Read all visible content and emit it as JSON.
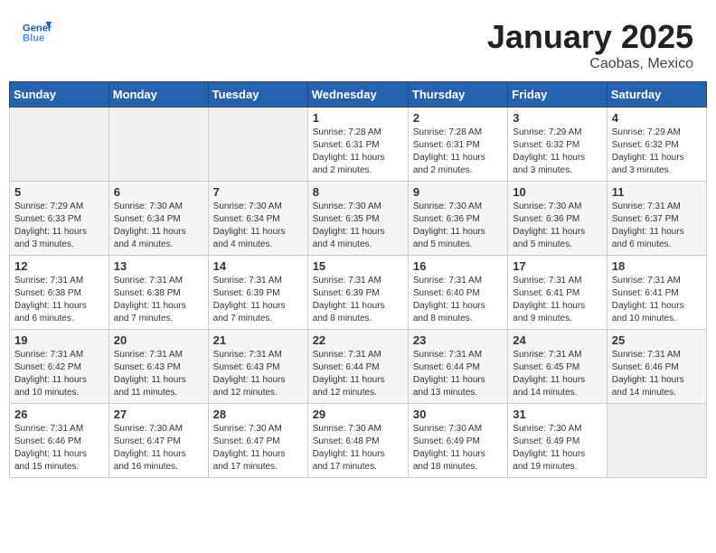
{
  "header": {
    "logo_line1": "General",
    "logo_line2": "Blue",
    "month": "January 2025",
    "location": "Caobas, Mexico"
  },
  "weekdays": [
    "Sunday",
    "Monday",
    "Tuesday",
    "Wednesday",
    "Thursday",
    "Friday",
    "Saturday"
  ],
  "weeks": [
    [
      {
        "day": "",
        "info": ""
      },
      {
        "day": "",
        "info": ""
      },
      {
        "day": "",
        "info": ""
      },
      {
        "day": "1",
        "info": "Sunrise: 7:28 AM\nSunset: 6:31 PM\nDaylight: 11 hours\nand 2 minutes."
      },
      {
        "day": "2",
        "info": "Sunrise: 7:28 AM\nSunset: 6:31 PM\nDaylight: 11 hours\nand 2 minutes."
      },
      {
        "day": "3",
        "info": "Sunrise: 7:29 AM\nSunset: 6:32 PM\nDaylight: 11 hours\nand 3 minutes."
      },
      {
        "day": "4",
        "info": "Sunrise: 7:29 AM\nSunset: 6:32 PM\nDaylight: 11 hours\nand 3 minutes."
      }
    ],
    [
      {
        "day": "5",
        "info": "Sunrise: 7:29 AM\nSunset: 6:33 PM\nDaylight: 11 hours\nand 3 minutes."
      },
      {
        "day": "6",
        "info": "Sunrise: 7:30 AM\nSunset: 6:34 PM\nDaylight: 11 hours\nand 4 minutes."
      },
      {
        "day": "7",
        "info": "Sunrise: 7:30 AM\nSunset: 6:34 PM\nDaylight: 11 hours\nand 4 minutes."
      },
      {
        "day": "8",
        "info": "Sunrise: 7:30 AM\nSunset: 6:35 PM\nDaylight: 11 hours\nand 4 minutes."
      },
      {
        "day": "9",
        "info": "Sunrise: 7:30 AM\nSunset: 6:36 PM\nDaylight: 11 hours\nand 5 minutes."
      },
      {
        "day": "10",
        "info": "Sunrise: 7:30 AM\nSunset: 6:36 PM\nDaylight: 11 hours\nand 5 minutes."
      },
      {
        "day": "11",
        "info": "Sunrise: 7:31 AM\nSunset: 6:37 PM\nDaylight: 11 hours\nand 6 minutes."
      }
    ],
    [
      {
        "day": "12",
        "info": "Sunrise: 7:31 AM\nSunset: 6:38 PM\nDaylight: 11 hours\nand 6 minutes."
      },
      {
        "day": "13",
        "info": "Sunrise: 7:31 AM\nSunset: 6:38 PM\nDaylight: 11 hours\nand 7 minutes."
      },
      {
        "day": "14",
        "info": "Sunrise: 7:31 AM\nSunset: 6:39 PM\nDaylight: 11 hours\nand 7 minutes."
      },
      {
        "day": "15",
        "info": "Sunrise: 7:31 AM\nSunset: 6:39 PM\nDaylight: 11 hours\nand 8 minutes."
      },
      {
        "day": "16",
        "info": "Sunrise: 7:31 AM\nSunset: 6:40 PM\nDaylight: 11 hours\nand 8 minutes."
      },
      {
        "day": "17",
        "info": "Sunrise: 7:31 AM\nSunset: 6:41 PM\nDaylight: 11 hours\nand 9 minutes."
      },
      {
        "day": "18",
        "info": "Sunrise: 7:31 AM\nSunset: 6:41 PM\nDaylight: 11 hours\nand 10 minutes."
      }
    ],
    [
      {
        "day": "19",
        "info": "Sunrise: 7:31 AM\nSunset: 6:42 PM\nDaylight: 11 hours\nand 10 minutes."
      },
      {
        "day": "20",
        "info": "Sunrise: 7:31 AM\nSunset: 6:43 PM\nDaylight: 11 hours\nand 11 minutes."
      },
      {
        "day": "21",
        "info": "Sunrise: 7:31 AM\nSunset: 6:43 PM\nDaylight: 11 hours\nand 12 minutes."
      },
      {
        "day": "22",
        "info": "Sunrise: 7:31 AM\nSunset: 6:44 PM\nDaylight: 11 hours\nand 12 minutes."
      },
      {
        "day": "23",
        "info": "Sunrise: 7:31 AM\nSunset: 6:44 PM\nDaylight: 11 hours\nand 13 minutes."
      },
      {
        "day": "24",
        "info": "Sunrise: 7:31 AM\nSunset: 6:45 PM\nDaylight: 11 hours\nand 14 minutes."
      },
      {
        "day": "25",
        "info": "Sunrise: 7:31 AM\nSunset: 6:46 PM\nDaylight: 11 hours\nand 14 minutes."
      }
    ],
    [
      {
        "day": "26",
        "info": "Sunrise: 7:31 AM\nSunset: 6:46 PM\nDaylight: 11 hours\nand 15 minutes."
      },
      {
        "day": "27",
        "info": "Sunrise: 7:30 AM\nSunset: 6:47 PM\nDaylight: 11 hours\nand 16 minutes."
      },
      {
        "day": "28",
        "info": "Sunrise: 7:30 AM\nSunset: 6:47 PM\nDaylight: 11 hours\nand 17 minutes."
      },
      {
        "day": "29",
        "info": "Sunrise: 7:30 AM\nSunset: 6:48 PM\nDaylight: 11 hours\nand 17 minutes."
      },
      {
        "day": "30",
        "info": "Sunrise: 7:30 AM\nSunset: 6:49 PM\nDaylight: 11 hours\nand 18 minutes."
      },
      {
        "day": "31",
        "info": "Sunrise: 7:30 AM\nSunset: 6:49 PM\nDaylight: 11 hours\nand 19 minutes."
      },
      {
        "day": "",
        "info": ""
      }
    ]
  ]
}
